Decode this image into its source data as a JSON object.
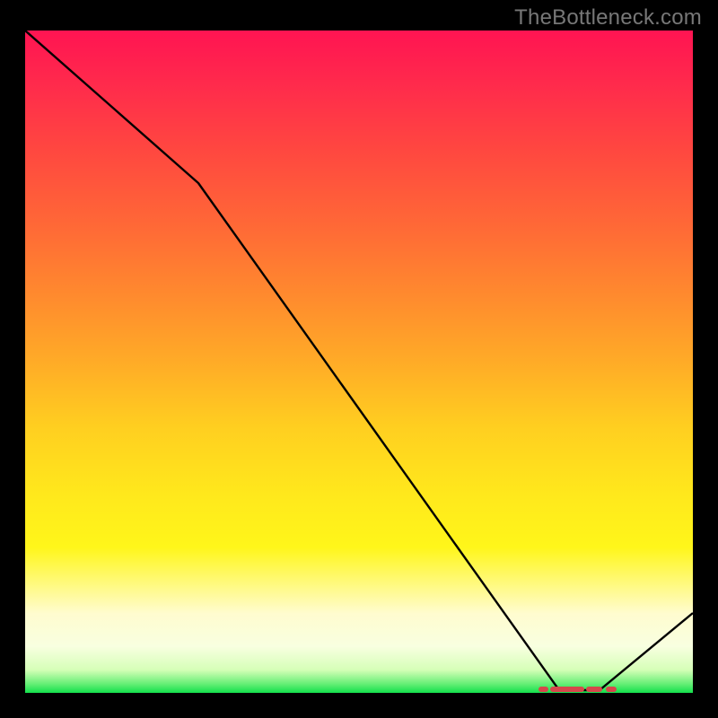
{
  "watermark": "TheBottleneck.com",
  "chart_data": {
    "type": "line",
    "title": "",
    "xlabel": "",
    "ylabel": "",
    "xlim": [
      0,
      100
    ],
    "ylim": [
      0,
      100
    ],
    "grid": false,
    "legend": false,
    "series": [
      {
        "name": "curve",
        "x": [
          0,
          26,
          80,
          86,
          100
        ],
        "values": [
          100,
          77,
          0,
          0,
          12
        ]
      }
    ],
    "annotations": {
      "trough_segment": {
        "x_start": 80,
        "x_end": 86,
        "y": 0,
        "marker": "red-dashes"
      }
    },
    "gradient_stops": [
      {
        "pct": 0,
        "color": "#ff1452"
      },
      {
        "pct": 30,
        "color": "#ff6a36"
      },
      {
        "pct": 60,
        "color": "#ffcf20"
      },
      {
        "pct": 88,
        "color": "#fffccf"
      },
      {
        "pct": 100,
        "color": "#14e04c"
      }
    ]
  }
}
